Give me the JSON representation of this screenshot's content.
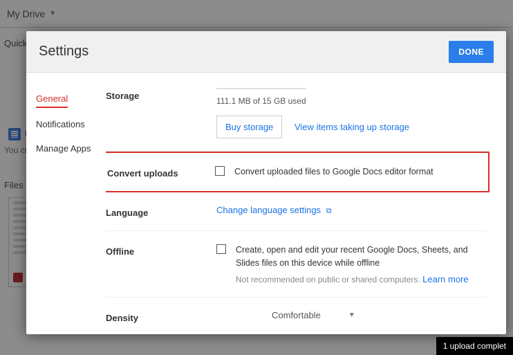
{
  "background": {
    "breadcrumb": "My Drive",
    "quick_label": "Quick A",
    "doc_label": "U",
    "you_label": "You cr",
    "files_label": "Files",
    "upload_toast": "1 upload complet"
  },
  "modal": {
    "title": "Settings",
    "done": "DONE",
    "nav": {
      "general": "General",
      "notifications": "Notifications",
      "manage_apps": "Manage Apps"
    },
    "storage": {
      "label": "Storage",
      "used": "111.1 MB of 15 GB used",
      "buy": "Buy storage",
      "view": "View items taking up storage"
    },
    "convert": {
      "label": "Convert uploads",
      "text": "Convert uploaded files to Google Docs editor format"
    },
    "language": {
      "label": "Language",
      "link": "Change language settings"
    },
    "offline": {
      "label": "Offline",
      "text": "Create, open and edit your recent Google Docs, Sheets, and Slides files on this device while offline",
      "sub_prefix": "Not recommended on public or shared computers. ",
      "learn": "Learn more"
    },
    "density": {
      "label": "Density",
      "value": "Comfortable"
    }
  }
}
